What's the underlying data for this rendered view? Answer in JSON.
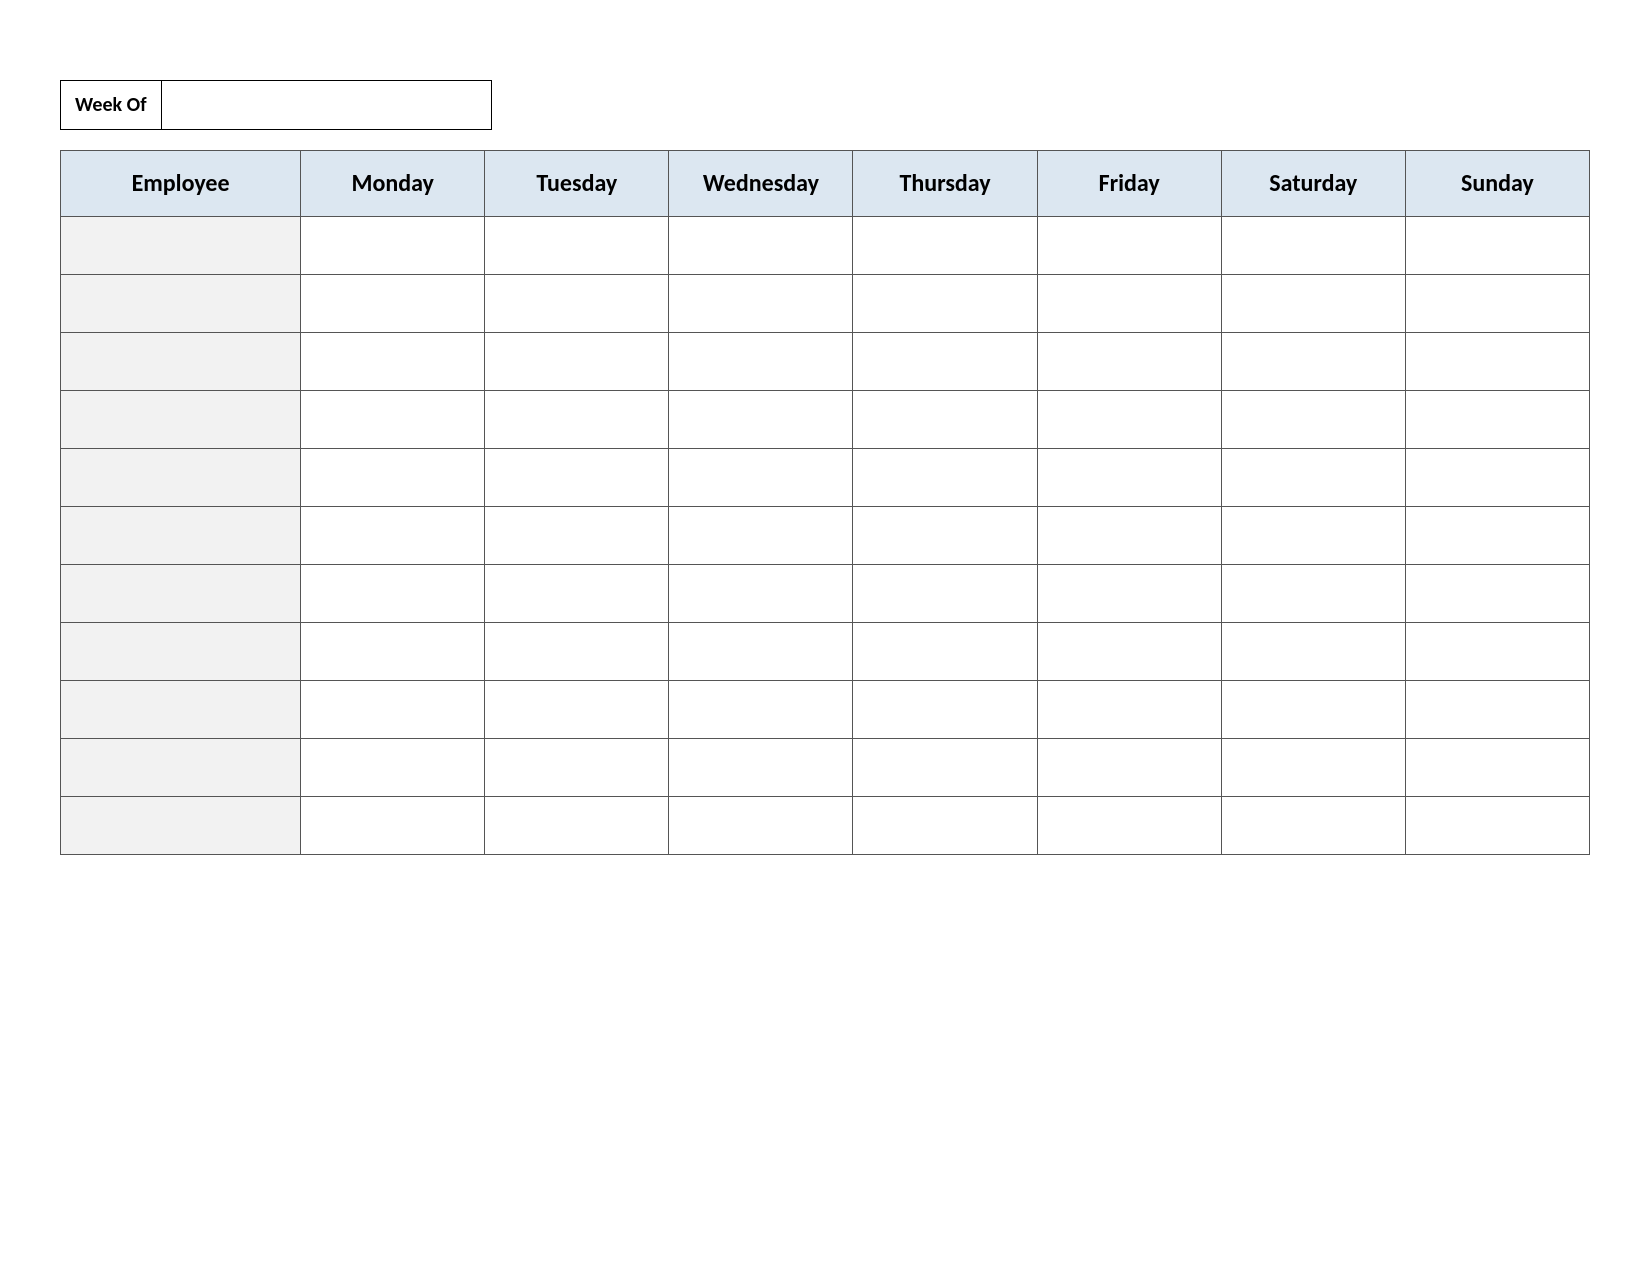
{
  "weekOf": {
    "label": "Week Of",
    "value": ""
  },
  "table": {
    "headers": {
      "employee": "Employee",
      "days": [
        "Monday",
        "Tuesday",
        "Wednesday",
        "Thursday",
        "Friday",
        "Saturday",
        "Sunday"
      ]
    },
    "rows": [
      {
        "employee": "",
        "cells": [
          "",
          "",
          "",
          "",
          "",
          "",
          ""
        ]
      },
      {
        "employee": "",
        "cells": [
          "",
          "",
          "",
          "",
          "",
          "",
          ""
        ]
      },
      {
        "employee": "",
        "cells": [
          "",
          "",
          "",
          "",
          "",
          "",
          ""
        ]
      },
      {
        "employee": "",
        "cells": [
          "",
          "",
          "",
          "",
          "",
          "",
          ""
        ]
      },
      {
        "employee": "",
        "cells": [
          "",
          "",
          "",
          "",
          "",
          "",
          ""
        ]
      },
      {
        "employee": "",
        "cells": [
          "",
          "",
          "",
          "",
          "",
          "",
          ""
        ]
      },
      {
        "employee": "",
        "cells": [
          "",
          "",
          "",
          "",
          "",
          "",
          ""
        ]
      },
      {
        "employee": "",
        "cells": [
          "",
          "",
          "",
          "",
          "",
          "",
          ""
        ]
      },
      {
        "employee": "",
        "cells": [
          "",
          "",
          "",
          "",
          "",
          "",
          ""
        ]
      },
      {
        "employee": "",
        "cells": [
          "",
          "",
          "",
          "",
          "",
          "",
          ""
        ]
      },
      {
        "employee": "",
        "cells": [
          "",
          "",
          "",
          "",
          "",
          "",
          ""
        ]
      }
    ]
  }
}
